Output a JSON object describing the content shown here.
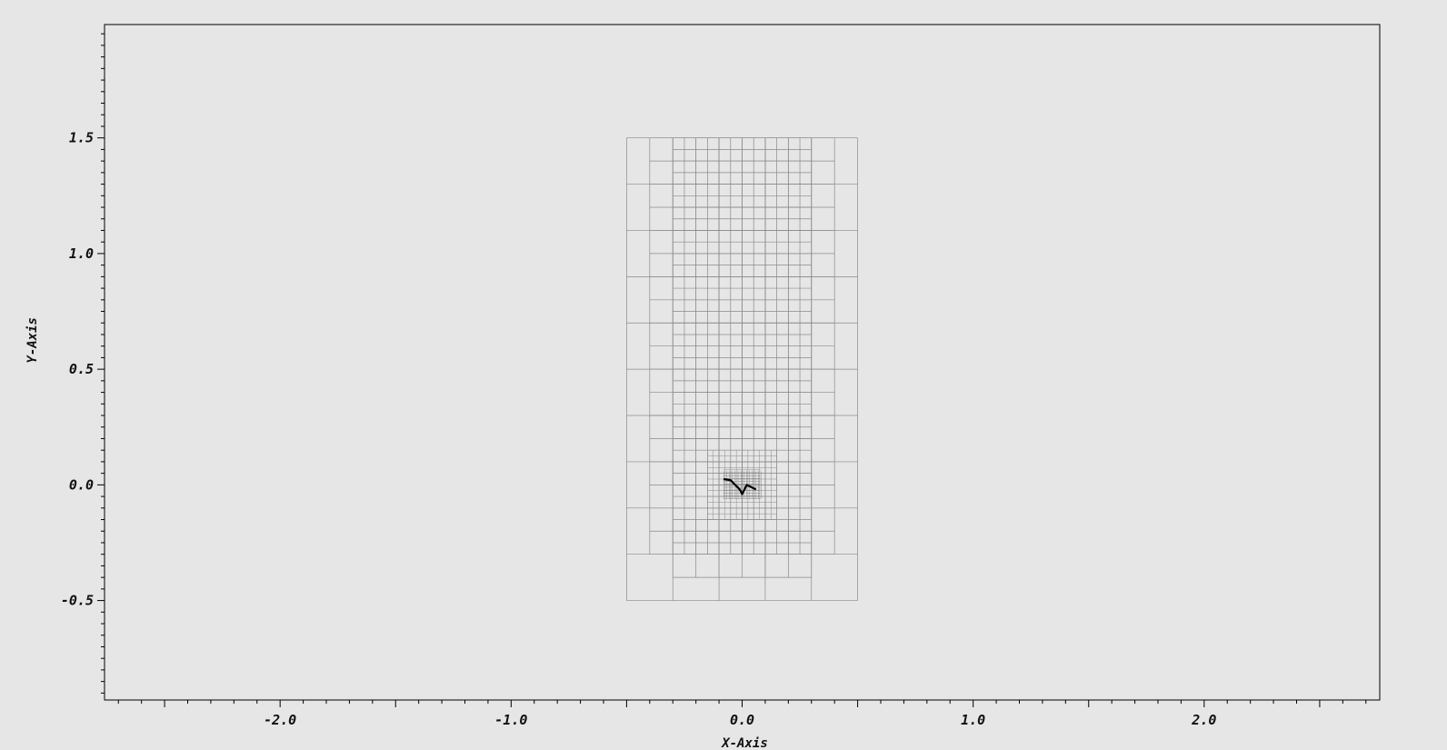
{
  "chart_data": {
    "type": "mesh",
    "xlabel": "X-Axis",
    "ylabel": "Y-Axis",
    "xlim": [
      -2.76,
      2.76
    ],
    "ylim": [
      -0.93,
      1.99
    ],
    "x_ticks": [
      {
        "value": -2.0,
        "label": "-2.0"
      },
      {
        "value": -1.0,
        "label": "-1.0"
      },
      {
        "value": 0.0,
        "label": "0.0"
      },
      {
        "value": 1.0,
        "label": "1.0"
      },
      {
        "value": 2.0,
        "label": "2.0"
      }
    ],
    "y_ticks": [
      {
        "value": -0.5,
        "label": "-0.5"
      },
      {
        "value": 0.0,
        "label": "0.0"
      },
      {
        "value": 0.5,
        "label": "0.5"
      },
      {
        "value": 1.0,
        "label": "1.0"
      },
      {
        "value": 1.5,
        "label": "1.5"
      }
    ],
    "minor_tick_step": 0.1,
    "grid": false,
    "mesh_domain": {
      "x": [
        -0.5,
        0.5
      ],
      "y": [
        -0.5,
        1.5
      ]
    },
    "mesh_levels": [
      {
        "level": 0,
        "x": [
          -0.5,
          0.5
        ],
        "y": [
          -0.5,
          1.5
        ],
        "cell_size": 0.2
      },
      {
        "level": 1,
        "x": [
          -0.4,
          0.4
        ],
        "y": [
          -0.3,
          1.5
        ],
        "cell_size": 0.1
      },
      {
        "level": 2,
        "x": [
          -0.3,
          0.3
        ],
        "y": [
          -0.3,
          1.5
        ],
        "cell_size": 0.05
      },
      {
        "level": 3,
        "x": [
          -0.3,
          0.3
        ],
        "y": [
          -0.4,
          -0.3
        ],
        "cell_size": 0.1
      },
      {
        "level": 4,
        "x": [
          -0.15,
          0.15
        ],
        "y": [
          -0.15,
          0.15
        ],
        "cell_size": 0.025
      },
      {
        "level": 5,
        "x": [
          -0.08,
          0.08
        ],
        "y": [
          -0.06,
          0.06
        ],
        "cell_size": 0.0125
      }
    ],
    "curve": {
      "x": [
        -0.08,
        -0.05,
        -0.03,
        -0.01,
        0.0,
        0.01,
        0.02,
        0.04,
        0.06
      ],
      "y": [
        0.025,
        0.02,
        0.0,
        -0.02,
        -0.04,
        -0.02,
        0.0,
        -0.01,
        -0.02
      ]
    },
    "colors": {
      "background": "#e6e6e6",
      "mesh": "#8a8a8a",
      "axis": "#000000",
      "curve": "#000000"
    }
  }
}
